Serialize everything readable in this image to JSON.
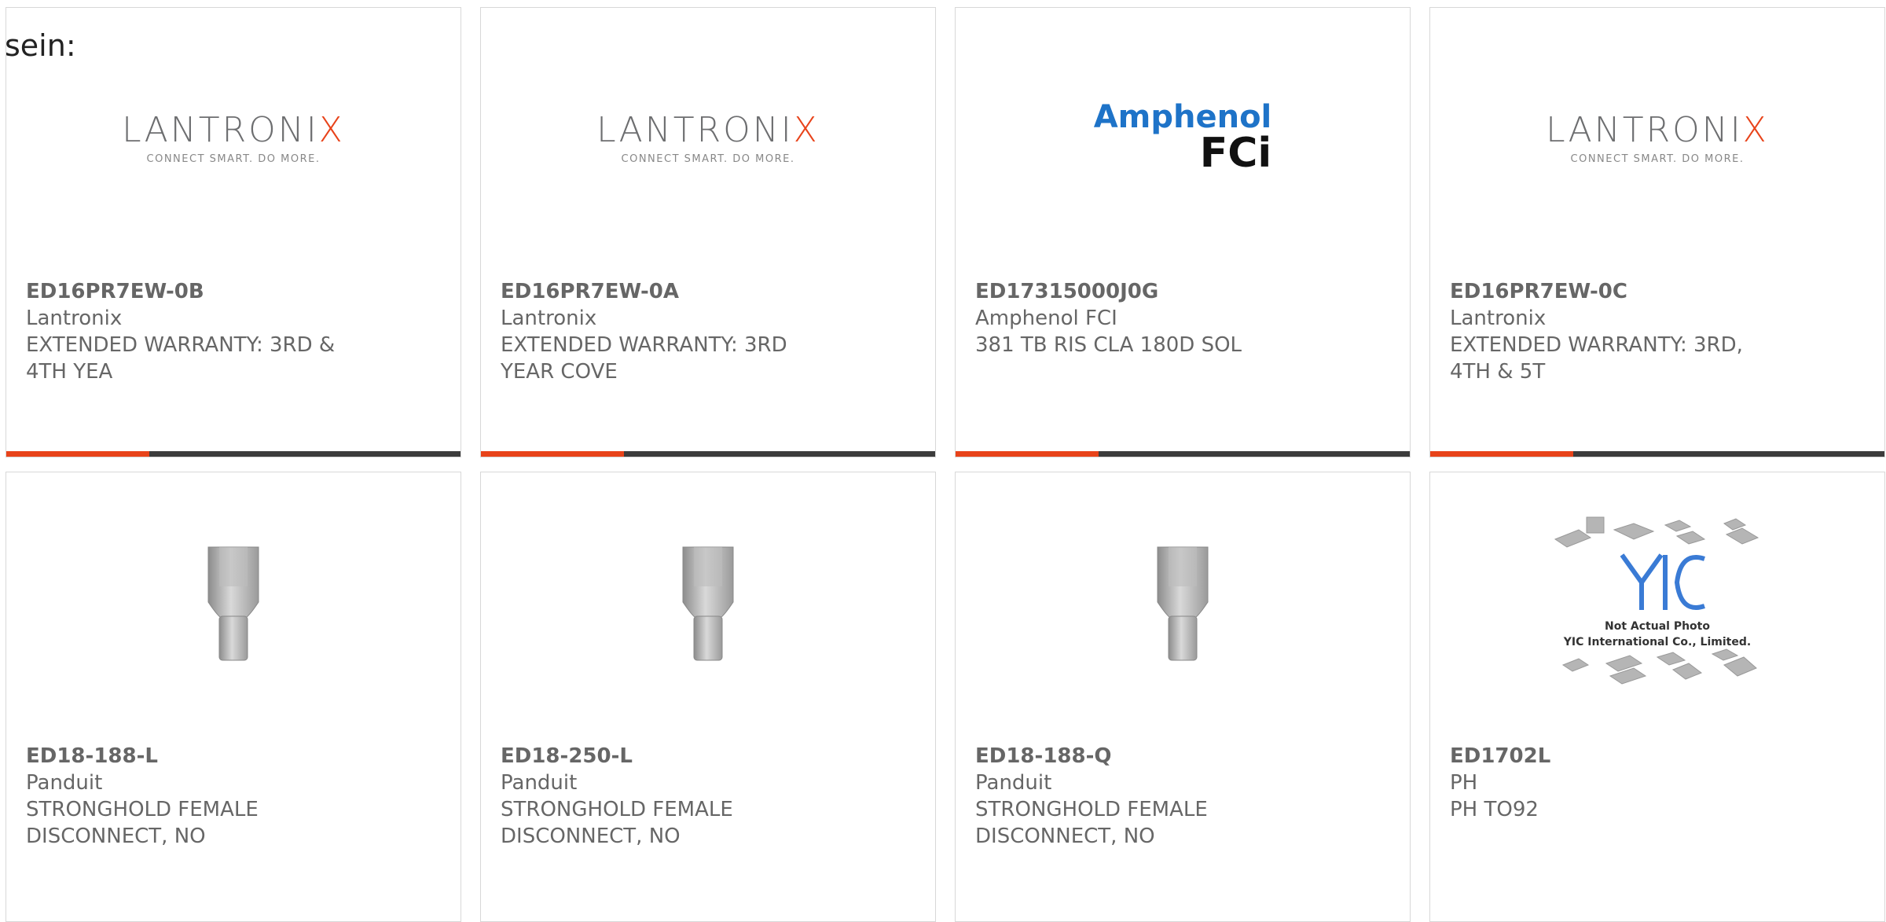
{
  "intro_text": "sein:",
  "products": [
    {
      "part_number": "ED16PR7EW-0B",
      "manufacturer": "Lantronix",
      "description": "EXTENDED WARRANTY: 3RD & 4TH YEA",
      "image": "lantronix-logo"
    },
    {
      "part_number": "ED16PR7EW-0A",
      "manufacturer": "Lantronix",
      "description": "EXTENDED WARRANTY: 3RD YEAR COVE",
      "image": "lantronix-logo"
    },
    {
      "part_number": "ED17315000J0G",
      "manufacturer": "Amphenol FCI",
      "description": "381 TB RIS CLA 180D SOL",
      "image": "amphenol-fci-logo"
    },
    {
      "part_number": "ED16PR7EW-0C",
      "manufacturer": "Lantronix",
      "description": "EXTENDED WARRANTY: 3RD, 4TH & 5T",
      "image": "lantronix-logo"
    },
    {
      "part_number": "ED18-188-L",
      "manufacturer": "Panduit",
      "description": "STRONGHOLD FEMALE DISCONNECT, NO",
      "image": "terminal-photo"
    },
    {
      "part_number": "ED18-250-L",
      "manufacturer": "Panduit",
      "description": "STRONGHOLD FEMALE DISCONNECT, NO",
      "image": "terminal-photo"
    },
    {
      "part_number": "ED18-188-Q",
      "manufacturer": "Panduit",
      "description": "STRONGHOLD FEMALE DISCONNECT, NO",
      "image": "terminal-photo"
    },
    {
      "part_number": "ED1702L",
      "manufacturer": "PH",
      "description": "PH TO92",
      "image": "yic-placeholder"
    }
  ],
  "logos": {
    "lantronix": {
      "name_main": "LANTRONI",
      "name_x": "X",
      "tagline": "CONNECT SMART. DO MORE."
    },
    "amphenol": {
      "line1": "Amphenol",
      "line2": "FCi"
    },
    "yic": {
      "line1": "Not Actual Photo",
      "line2": "YIC International Co., Limited."
    }
  },
  "colors": {
    "accent": "#e8431a",
    "bar": "#3c3c3c",
    "text": "#666666"
  }
}
